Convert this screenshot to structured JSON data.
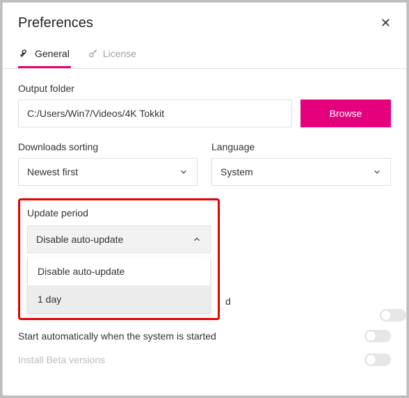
{
  "header": {
    "title": "Preferences",
    "close": "✕"
  },
  "tabs": {
    "general": "General",
    "license": "License"
  },
  "output": {
    "label": "Output folder",
    "value": "C:/Users/Win7/Videos/4K Tokkit",
    "browse": "Browse"
  },
  "sorting": {
    "label": "Downloads sorting",
    "value": "Newest first"
  },
  "language": {
    "label": "Language",
    "value": "System"
  },
  "update": {
    "label": "Update period",
    "value": "Disable auto-update",
    "options": {
      "opt0": "Disable auto-update",
      "opt1": "1 day"
    }
  },
  "partial_text": "d",
  "settings": {
    "start_with_system": "Start automatically when the system is started",
    "install_beta": "Install Beta versions"
  }
}
